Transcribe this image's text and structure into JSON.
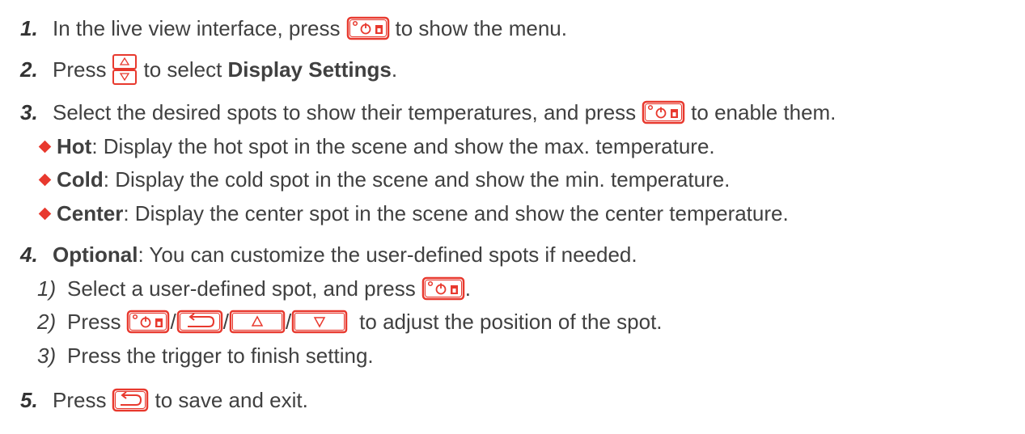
{
  "colors": {
    "accent": "#e8392e",
    "text": "#404040"
  },
  "steps": [
    {
      "num": "1.",
      "before": "In the live view interface, press",
      "icon": "power-button-icon",
      "after": "to show the menu."
    },
    {
      "num": "2.",
      "before": "Press",
      "icon": "up-down-button-icon",
      "after_pre": "to select",
      "bold": "Display Settings",
      "after": "."
    },
    {
      "num": "3.",
      "before": "Select the desired spots to show their temperatures, and press",
      "icon": "power-button-icon",
      "after": "to enable them."
    },
    {
      "num": "4.",
      "bold": "Optional",
      "after": ": You can customize the user-defined spots if needed."
    },
    {
      "num": "5.",
      "before": "Press",
      "icon": "back-button-icon",
      "after": "to save and exit."
    }
  ],
  "bullets": [
    {
      "bold": "Hot",
      "text": ": Display the hot spot in the scene and show the max. temperature."
    },
    {
      "bold": "Cold",
      "text": ": Display the cold spot in the scene and show the min. temperature."
    },
    {
      "bold": "Center",
      "text": ": Display the center spot in the scene and show the center temperature."
    }
  ],
  "substeps": [
    {
      "num": "1)",
      "text": "Select a user-defined spot, and press",
      "after": "."
    },
    {
      "num": "2)",
      "before": "Press",
      "sep": "/",
      "after": "to adjust the position of the spot."
    },
    {
      "num": "3)",
      "text": "Press the trigger to finish setting."
    }
  ]
}
